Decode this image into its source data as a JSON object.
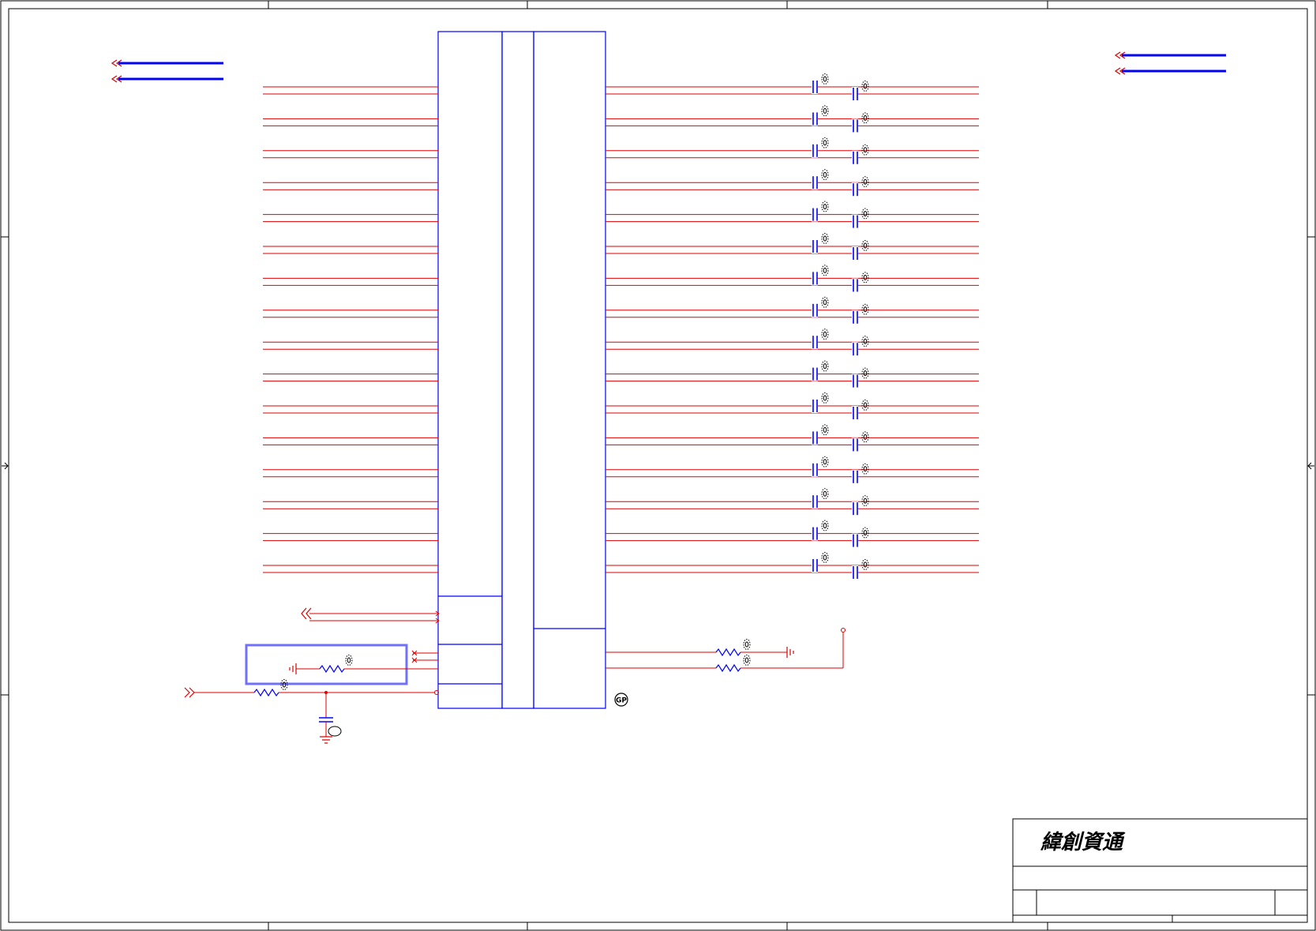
{
  "title_block": {
    "company_logo": "緯創資通"
  },
  "colors": {
    "frame": "#000000",
    "component": "#0000ff",
    "net": "#e00000",
    "highlight": "#7070ff"
  },
  "diagram": {
    "lane_pairs": 16,
    "main_ic_blocks": 3,
    "placement_marks": [
      "GP"
    ]
  }
}
